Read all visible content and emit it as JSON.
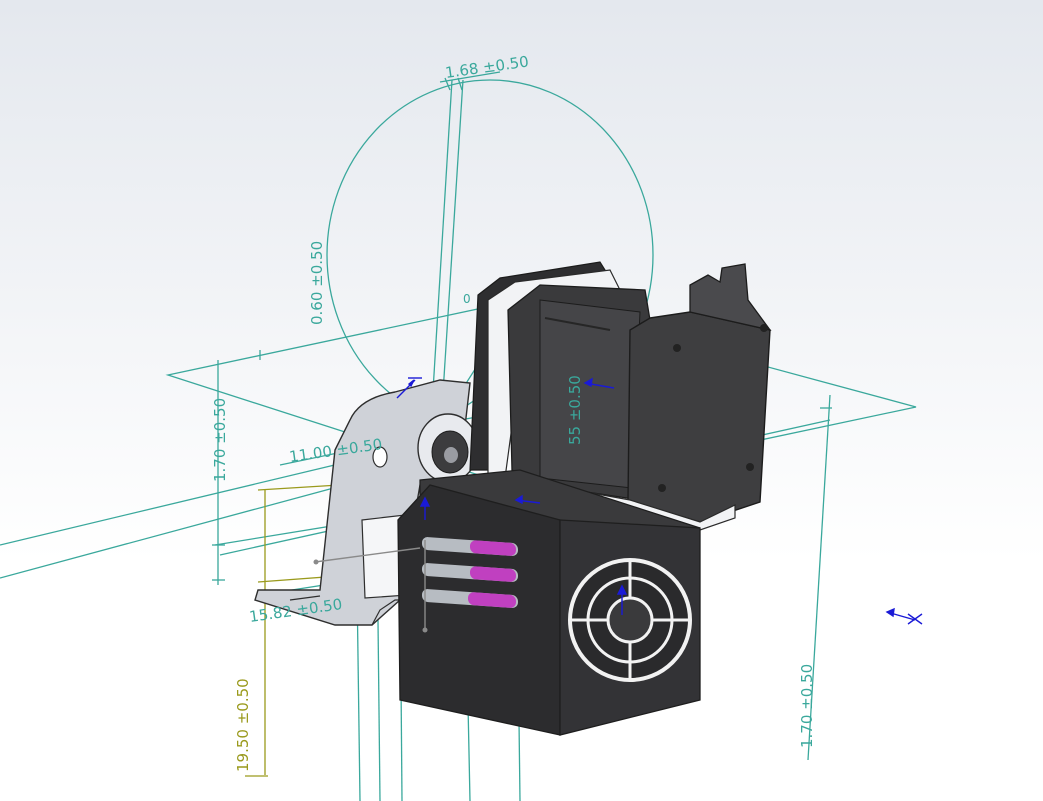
{
  "viewport": {
    "name": "cad-graphics-area",
    "background_top": "#e4e8ee",
    "background_bottom": "#ffffff"
  },
  "colors": {
    "sketch_line": "#3aa89c",
    "yellow_dim": "#9a9a1c",
    "blue_triad": "#1a1ad6",
    "motor_dark": "#3c3c3e",
    "housing_black": "#2c2c2e",
    "bracket_grey": "#c9ccd2",
    "vent_magenta": "#c040c0"
  },
  "dimensions": {
    "top_tolerance": "1.68 ±0.50",
    "left_vertical": "0.60 ±0.50",
    "left_small_vertical": "1.70 ±0.50",
    "center_motor": "55 ±0.50",
    "left_horizontal": "11.00 ±0.50",
    "bottom_left": "15.82 ±0.50",
    "yellow_vertical": "19.50 ±0.50",
    "right_vertical": "1.70 ±0.50",
    "zero_label": "0"
  },
  "icons": {
    "triad_a": "coordinate-triad-icon",
    "triad_b": "coordinate-triad-icon",
    "triad_c": "coordinate-triad-icon",
    "triad_d": "coordinate-triad-icon"
  }
}
